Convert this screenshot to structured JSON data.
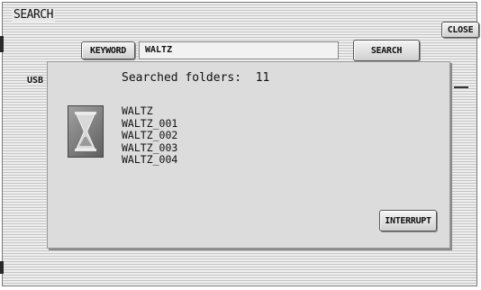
{
  "window": {
    "title": "SEARCH"
  },
  "toolbar": {
    "close_label": "CLOSE",
    "keyword_label": "KEYWORD",
    "keyword_value": "WALTZ",
    "search_label": "SEARCH"
  },
  "background_tab": {
    "label": "USB"
  },
  "dialog": {
    "count_label": "Searched folders:",
    "count_value": "11",
    "results": [
      "WALTZ",
      "WALTZ_001",
      "WALTZ_002",
      "WALTZ_003",
      "WALTZ_004"
    ],
    "interrupt_label": "INTERRUPT",
    "busy_icon": "hourglass-icon"
  }
}
